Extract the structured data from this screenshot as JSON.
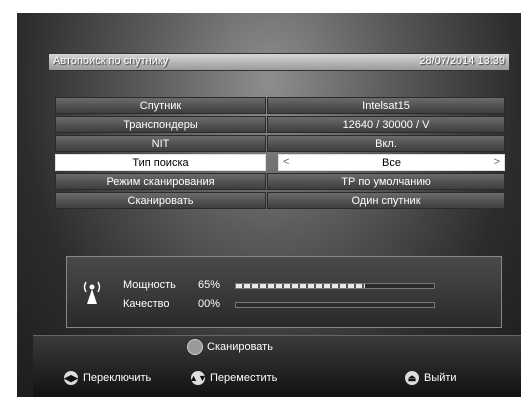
{
  "header": {
    "title": "Автопоиск по спутнику",
    "datetime": "28/07/2014 13:39"
  },
  "menu": {
    "rows": [
      {
        "label": "Спутник",
        "value": "Intelsat15"
      },
      {
        "label": "Транспондеры",
        "value": "12640 / 30000 / V"
      },
      {
        "label": "NIT",
        "value": "Вкл."
      },
      {
        "label": "Тип поиска",
        "value": "Все"
      },
      {
        "label": "Режим сканирования",
        "value": "ТР по умолчанию"
      },
      {
        "label": "Сканировать",
        "value": "Один спутник"
      }
    ],
    "selected_index": 3,
    "left_arrow": "<",
    "right_arrow": ">"
  },
  "signal": {
    "power_label": "Мощность",
    "power_value": "65%",
    "power_level": 0.65,
    "quality_label": "Качество",
    "quality_value": "00%",
    "quality_level": 0.0,
    "icon": "antenna-icon"
  },
  "footer": {
    "scan_label": "Сканировать",
    "switch_label": "Переключить",
    "move_label": "Переместить",
    "exit_label": "Выйти",
    "icons": {
      "scan": "green-button-icon",
      "switch": "left-right-arrow-icon",
      "move": "up-down-arrow-icon",
      "exit": "exit-icon"
    }
  }
}
